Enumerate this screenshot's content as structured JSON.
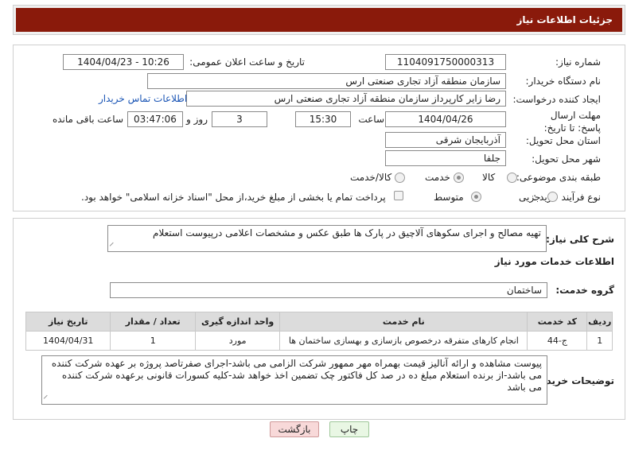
{
  "header": {
    "title": "جزئیات اطلاعات نیاز"
  },
  "form": {
    "need_number_label": "شماره نیاز:",
    "need_number": "1104091750000313",
    "announce_label": "تاریخ و ساعت اعلان عمومی:",
    "announce_value": "1404/04/23 - 10:26",
    "buyer_org_label": "نام دستگاه خریدار:",
    "buyer_org": "سازمان منطقه آزاد تجاری صنعتی ارس",
    "creator_label": "ایجاد کننده درخواست:",
    "creator": "رضا زایر کارپرداز سازمان منطقه آزاد تجاری صنعتی ارس",
    "contact_link": "اطلاعات تماس خریدار",
    "deadline_label": "مهلت ارسال پاسخ: تا تاریخ:",
    "deadline_date": "1404/04/26",
    "time_label": "ساعت",
    "deadline_time": "15:30",
    "days_value": "3",
    "days_label": "روز و",
    "remaining_time": "03:47:06",
    "remaining_label": "ساعت باقی مانده",
    "province_label": "استان محل تحویل:",
    "province": "آذربایجان شرقی",
    "city_label": "شهر محل تحویل:",
    "city": "جلفا",
    "category_label": "طبقه بندی موضوعی:",
    "category_options": [
      "کالا",
      "خدمت",
      "کالا/خدمت"
    ],
    "category_selected": "خدمت",
    "process_label": "نوع فرآیند خرید :",
    "process_options": [
      "جزیی",
      "متوسط"
    ],
    "process_selected": "متوسط",
    "payment_note": "پرداخت تمام یا بخشی از مبلغ خرید،از محل \"اسناد خزانه اسلامی\" خواهد بود."
  },
  "summary": {
    "label": "شرح کلی نیاز:",
    "text": "تهیه مصالح و اجرای سکوهای آلاچیق در پارک ها طبق عکس و مشخصات اعلامی درپیوست استعلام"
  },
  "services": {
    "section_title": "اطلاعات خدمات مورد نیاز",
    "group_label": "گروه خدمت:",
    "group_value": "ساختمان",
    "columns": [
      "ردیف",
      "کد خدمت",
      "نام خدمت",
      "واحد اندازه گیری",
      "تعداد / مقدار",
      "تاریخ نیاز"
    ],
    "rows": [
      [
        "1",
        "ج-44",
        "انجام کارهای متفرقه درخصوص بازسازی و بهسازی ساختمان ها",
        "مورد",
        "1",
        "1404/04/31"
      ]
    ]
  },
  "buyer_notes": {
    "label": "توضیحات خریدار:",
    "text": "پیوست مشاهده و ارائه آنالیز قیمت بهمراه مهر ممهور شرکت الزامی می باشد-اجرای صفرتاصد پروژه بر عهده شرکت کننده می باشد-از برنده استعلام مبلغ ده در صد کل فاکتور چک تضمین اخذ خواهد شد-کلیه کسورات قانونی برعهده شرکت کننده می باشد"
  },
  "buttons": {
    "print": "چاپ",
    "back": "بازگشت"
  },
  "watermark": {
    "text": "AriaTender.net"
  },
  "colors": {
    "header_bg": "#8a1a0b",
    "link": "#1a55b5",
    "back_bg": "#f8d9d9",
    "print_bg": "#e9f7e4",
    "watermark": "#d88a8a"
  }
}
